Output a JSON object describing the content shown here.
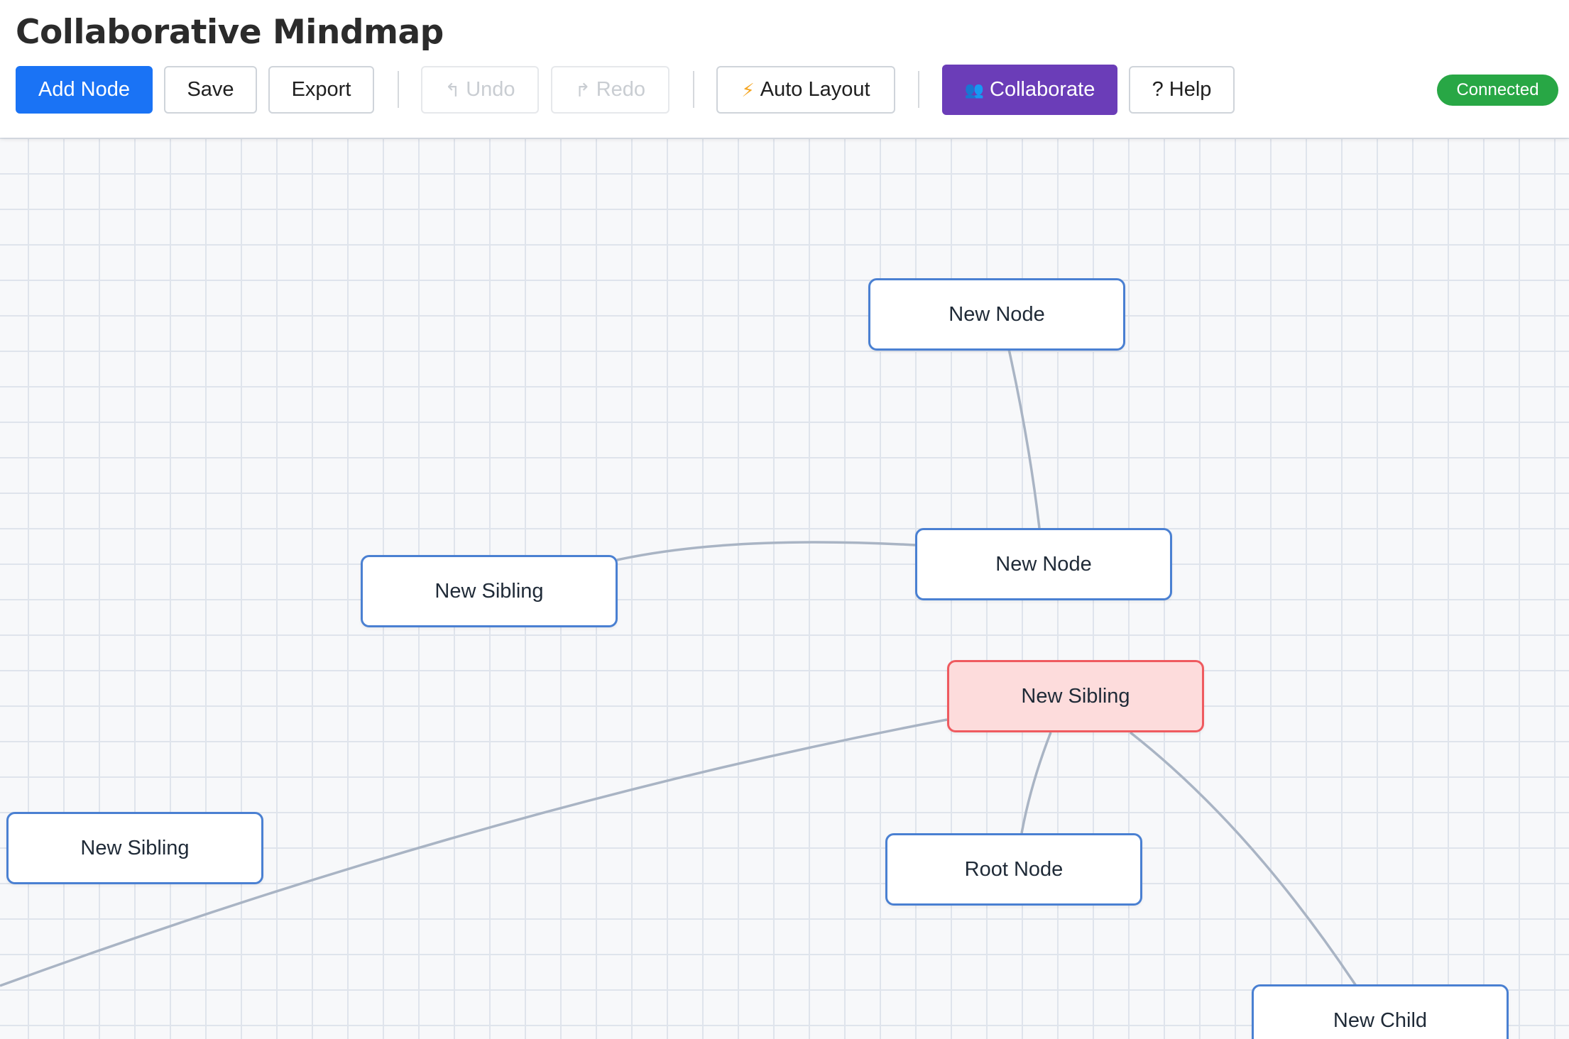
{
  "app": {
    "title": "Collaborative Mindmap"
  },
  "toolbar": {
    "add_node": "Add Node",
    "save": "Save",
    "export": "Export",
    "undo": "Undo",
    "undo_icon": "↰",
    "redo": "Redo",
    "redo_icon": "↱",
    "auto_layout": "Auto Layout",
    "auto_layout_icon": "⚡",
    "collaborate": "Collaborate",
    "collaborate_icon": "👥",
    "help": "? Help"
  },
  "status": {
    "label": "Connected",
    "color": "#28a745"
  },
  "colors": {
    "primary": "#1a73f5",
    "collaborate": "#6b3db8",
    "node_border": "#4a80d2",
    "selected_border": "#ef5a5f",
    "selected_fill": "#fddcdc",
    "edge": "#a9b4c4"
  },
  "nodes": [
    {
      "label": "New Node",
      "selected": false
    },
    {
      "label": "New Node",
      "selected": false
    },
    {
      "label": "New Sibling",
      "selected": false
    },
    {
      "label": "New Sibling",
      "selected": true
    },
    {
      "label": "New Sibling",
      "selected": false
    },
    {
      "label": "Root Node",
      "selected": false
    },
    {
      "label": "New Child",
      "selected": false
    }
  ]
}
